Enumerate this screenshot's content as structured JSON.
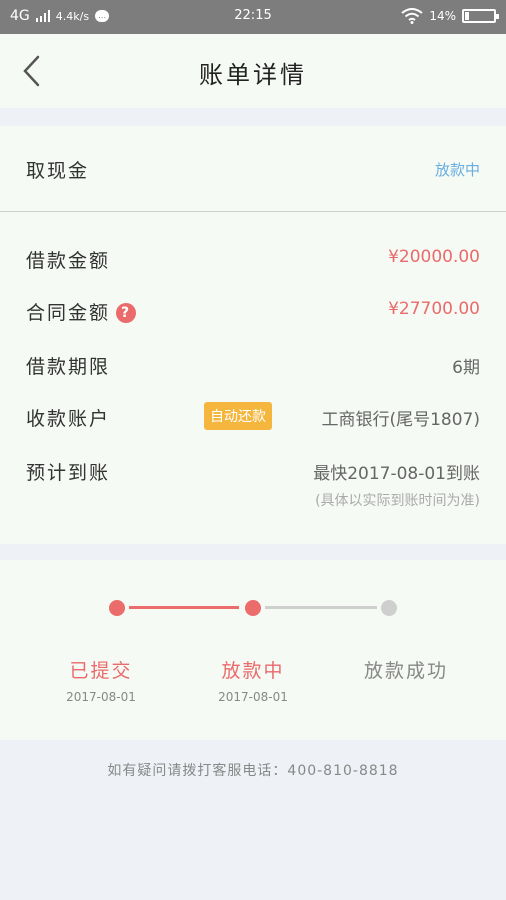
{
  "status_bar": {
    "network": "4G",
    "speed": "4.4k/s",
    "chat_badge": "…",
    "time": "22:15",
    "battery": "14%",
    "battery_level": 0.14
  },
  "nav": {
    "title": "账单详情"
  },
  "loan": {
    "type_label": "取现金",
    "status": "放款中",
    "rows": [
      {
        "label": "借款金额",
        "value": "¥20000.00"
      },
      {
        "label": "合同金额",
        "value": "¥27700.00"
      },
      {
        "label": "借款期限",
        "value": "6期"
      },
      {
        "label": "收款账户",
        "badge": "自动还款",
        "value": "工商银行(尾号1807)"
      },
      {
        "label": "预计到账",
        "value": "最快2017-08-01到账"
      }
    ],
    "help_icon": "?",
    "note": "(具体以实际到账时间为准)"
  },
  "progress": {
    "steps": [
      {
        "label": "已提交",
        "date": "2017-08-01",
        "state": "done"
      },
      {
        "label": "放款中",
        "date": "2017-08-01",
        "state": "done"
      },
      {
        "label": "放款成功",
        "date": "",
        "state": "pending"
      }
    ]
  },
  "footer": {
    "tip": "如有疑问请拨打客服电话：400-810-8818"
  },
  "colors": {
    "accent_red": "#e96b6b",
    "status_blue": "#68aee0",
    "badge_orange": "#f4b63d",
    "pending_gray": "#cfcfcf"
  },
  "icons": {
    "back": "chevron-left-icon",
    "wifi": "wifi-icon",
    "signal": "signal-icon",
    "battery": "battery-icon",
    "help": "question-circle-icon"
  }
}
